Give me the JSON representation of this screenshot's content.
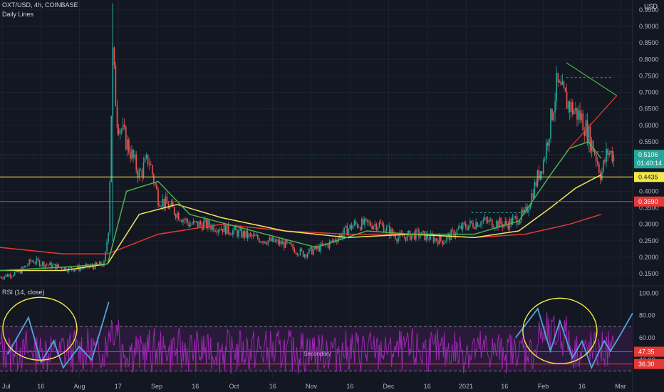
{
  "header": {
    "symbol_line": "OXT/USD, 4h, COINBASE",
    "study_label": "Daily Lines",
    "rsi_label": "RSI (14, close)",
    "currency": "USD",
    "annotation": "Secondary"
  },
  "colors": {
    "background": "#131722",
    "grid": "#1e222d",
    "axis_text": "#b2b5be",
    "candle_up": "#26a69a",
    "candle_down": "#ef5350",
    "ma_green": "#4caf50",
    "ma_yellow": "#f2e35a",
    "ma_red": "#e53935",
    "support_yellow": "#f5e94a",
    "support_red": "#e53935",
    "rsi_line": "#9c27b0",
    "rsi_band": "#2a1a3a",
    "zigzag": "#4fa3e0",
    "circle": "#f5e94a",
    "triangle_green": "#4caf50",
    "triangle_red": "#e53935"
  },
  "chart_data": [
    {
      "type": "candlestick",
      "symbol": "OXT/USD",
      "interval": "4h",
      "exchange": "COINBASE",
      "y_ticks": [
        "0.1500",
        "0.2000",
        "0.2500",
        "0.3000",
        "0.3500",
        "0.4000",
        "0.4500",
        "0.5000",
        "0.5500",
        "0.6000",
        "0.6500",
        "0.7000",
        "0.7500",
        "0.8000",
        "0.8500",
        "0.9000",
        "0.9500"
      ],
      "ylim": [
        0.12,
        0.98
      ],
      "x_ticks": [
        "Jul",
        "16",
        "Aug",
        "17",
        "Sep",
        "16",
        "Oct",
        "16",
        "Nov",
        "16",
        "Dec",
        "16",
        "2021",
        "16",
        "Feb",
        "16",
        "Mar"
      ],
      "anchors_price": [
        {
          "t": 0,
          "p": 0.14
        },
        {
          "t": 0.03,
          "p": 0.155
        },
        {
          "t": 0.05,
          "p": 0.19
        },
        {
          "t": 0.08,
          "p": 0.175
        },
        {
          "t": 0.11,
          "p": 0.165
        },
        {
          "t": 0.14,
          "p": 0.17
        },
        {
          "t": 0.165,
          "p": 0.18
        },
        {
          "t": 0.172,
          "p": 0.3
        },
        {
          "t": 0.178,
          "p": 0.82
        },
        {
          "t": 0.185,
          "p": 0.62
        },
        {
          "t": 0.2,
          "p": 0.55
        },
        {
          "t": 0.22,
          "p": 0.45
        },
        {
          "t": 0.235,
          "p": 0.5
        },
        {
          "t": 0.25,
          "p": 0.38
        },
        {
          "t": 0.27,
          "p": 0.35
        },
        {
          "t": 0.3,
          "p": 0.3
        },
        {
          "t": 0.32,
          "p": 0.3
        },
        {
          "t": 0.35,
          "p": 0.29
        },
        {
          "t": 0.4,
          "p": 0.26
        },
        {
          "t": 0.45,
          "p": 0.24
        },
        {
          "t": 0.48,
          "p": 0.21
        },
        {
          "t": 0.52,
          "p": 0.24
        },
        {
          "t": 0.56,
          "p": 0.3
        },
        {
          "t": 0.6,
          "p": 0.3
        },
        {
          "t": 0.63,
          "p": 0.26
        },
        {
          "t": 0.66,
          "p": 0.27
        },
        {
          "t": 0.7,
          "p": 0.25
        },
        {
          "t": 0.73,
          "p": 0.29
        },
        {
          "t": 0.76,
          "p": 0.31
        },
        {
          "t": 0.8,
          "p": 0.3
        },
        {
          "t": 0.83,
          "p": 0.33
        },
        {
          "t": 0.86,
          "p": 0.5
        },
        {
          "t": 0.88,
          "p": 0.72
        },
        {
          "t": 0.9,
          "p": 0.66
        },
        {
          "t": 0.92,
          "p": 0.62
        },
        {
          "t": 0.94,
          "p": 0.52
        },
        {
          "t": 0.95,
          "p": 0.45
        },
        {
          "t": 0.96,
          "p": 0.52
        },
        {
          "t": 0.97,
          "p": 0.51
        }
      ],
      "ma_green": [
        {
          "t": 0,
          "p": 0.16
        },
        {
          "t": 0.1,
          "p": 0.17
        },
        {
          "t": 0.17,
          "p": 0.18
        },
        {
          "t": 0.2,
          "p": 0.4
        },
        {
          "t": 0.25,
          "p": 0.43
        },
        {
          "t": 0.3,
          "p": 0.33
        },
        {
          "t": 0.4,
          "p": 0.28
        },
        {
          "t": 0.5,
          "p": 0.23
        },
        {
          "t": 0.58,
          "p": 0.28
        },
        {
          "t": 0.65,
          "p": 0.27
        },
        {
          "t": 0.75,
          "p": 0.27
        },
        {
          "t": 0.82,
          "p": 0.31
        },
        {
          "t": 0.87,
          "p": 0.45
        },
        {
          "t": 0.9,
          "p": 0.53
        },
        {
          "t": 0.93,
          "p": 0.55
        },
        {
          "t": 0.95,
          "p": 0.5
        }
      ],
      "ma_yellow": [
        {
          "t": 0,
          "p": 0.16
        },
        {
          "t": 0.1,
          "p": 0.16
        },
        {
          "t": 0.17,
          "p": 0.18
        },
        {
          "t": 0.22,
          "p": 0.33
        },
        {
          "t": 0.28,
          "p": 0.36
        },
        {
          "t": 0.35,
          "p": 0.32
        },
        {
          "t": 0.45,
          "p": 0.28
        },
        {
          "t": 0.55,
          "p": 0.26
        },
        {
          "t": 0.65,
          "p": 0.27
        },
        {
          "t": 0.75,
          "p": 0.26
        },
        {
          "t": 0.82,
          "p": 0.28
        },
        {
          "t": 0.87,
          "p": 0.35
        },
        {
          "t": 0.91,
          "p": 0.41
        },
        {
          "t": 0.95,
          "p": 0.45
        }
      ],
      "ma_red": [
        {
          "t": 0,
          "p": 0.23
        },
        {
          "t": 0.1,
          "p": 0.21
        },
        {
          "t": 0.17,
          "p": 0.21
        },
        {
          "t": 0.25,
          "p": 0.27
        },
        {
          "t": 0.35,
          "p": 0.3
        },
        {
          "t": 0.45,
          "p": 0.28
        },
        {
          "t": 0.55,
          "p": 0.27
        },
        {
          "t": 0.65,
          "p": 0.27
        },
        {
          "t": 0.75,
          "p": 0.26
        },
        {
          "t": 0.83,
          "p": 0.27
        },
        {
          "t": 0.9,
          "p": 0.3
        },
        {
          "t": 0.95,
          "p": 0.33
        }
      ],
      "horizontal_levels": [
        {
          "price": 0.4435,
          "label": "0.4435",
          "color": "#f5e94a"
        },
        {
          "price": 0.369,
          "label": "0.3690",
          "color": "#e53935"
        }
      ],
      "last_price": {
        "value": "0.5106",
        "countdown": "01:40:14",
        "color": "#26a69a"
      }
    },
    {
      "type": "line",
      "name": "RSI (14, close)",
      "y_ticks": [
        "100.00",
        "80.00",
        "60.00",
        "40.00"
      ],
      "ylim": [
        24,
        104
      ],
      "band": [
        30,
        70
      ],
      "levels": [
        {
          "value": 47.35,
          "label": "47.35",
          "color": "#e53935"
        },
        {
          "value": 36.3,
          "label": "36.30",
          "color": "#e53935"
        }
      ],
      "zigzag_left": [
        {
          "t": 0.012,
          "v": 45
        },
        {
          "t": 0.045,
          "v": 78
        },
        {
          "t": 0.065,
          "v": 38
        },
        {
          "t": 0.085,
          "v": 57
        },
        {
          "t": 0.1,
          "v": 33
        },
        {
          "t": 0.125,
          "v": 52
        },
        {
          "t": 0.145,
          "v": 40
        },
        {
          "t": 0.172,
          "v": 92
        }
      ],
      "zigzag_right": [
        {
          "t": 0.815,
          "v": 60
        },
        {
          "t": 0.85,
          "v": 86
        },
        {
          "t": 0.87,
          "v": 48
        },
        {
          "t": 0.885,
          "v": 75
        },
        {
          "t": 0.905,
          "v": 42
        },
        {
          "t": 0.92,
          "v": 57
        },
        {
          "t": 0.935,
          "v": 33
        },
        {
          "t": 0.955,
          "v": 57
        },
        {
          "t": 0.965,
          "v": 48
        },
        {
          "t": 0.98,
          "v": 62
        },
        {
          "t": 1.0,
          "v": 82
        }
      ]
    }
  ]
}
